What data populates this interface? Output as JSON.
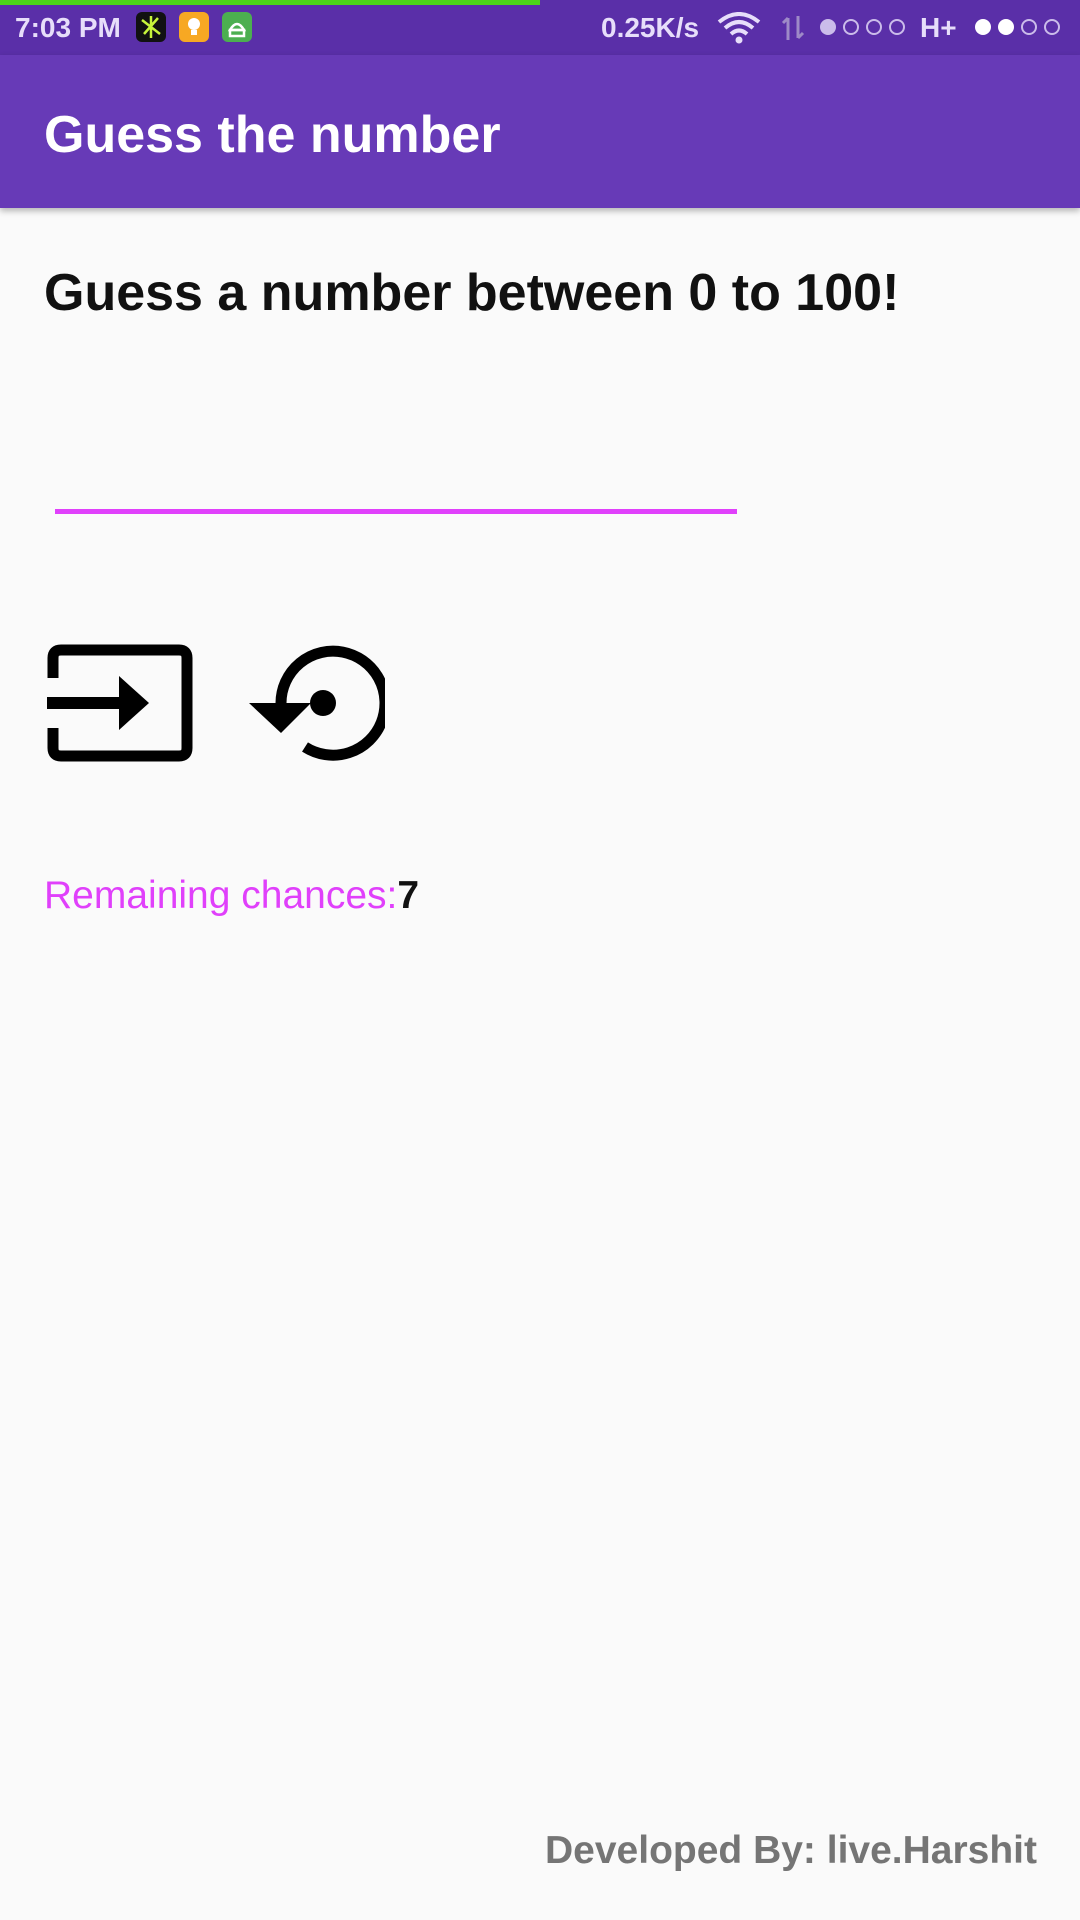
{
  "status_bar": {
    "time": "7:03 PM",
    "speed": "0.25K/s",
    "network_type": "H+",
    "icons": [
      "app-icon-1",
      "lightbulb-icon",
      "android-icon",
      "wifi-icon",
      "data-arrows-icon",
      "signal-dots-icon"
    ],
    "colors": {
      "background": "#5a2fa8",
      "progress": "#4cd31a"
    }
  },
  "app_bar": {
    "title": "Guess the number",
    "color": "#673ab7"
  },
  "main": {
    "heading": "Guess a number between 0 to 100!",
    "input": {
      "value": "",
      "placeholder": "",
      "accent": "#e040fb"
    },
    "buttons": [
      {
        "icon": "input-icon"
      },
      {
        "icon": "restore-icon"
      }
    ],
    "chances_label": "Remaining chances:",
    "chances_value": "7"
  },
  "footer": {
    "text": "Developed By: live.Harshit"
  }
}
